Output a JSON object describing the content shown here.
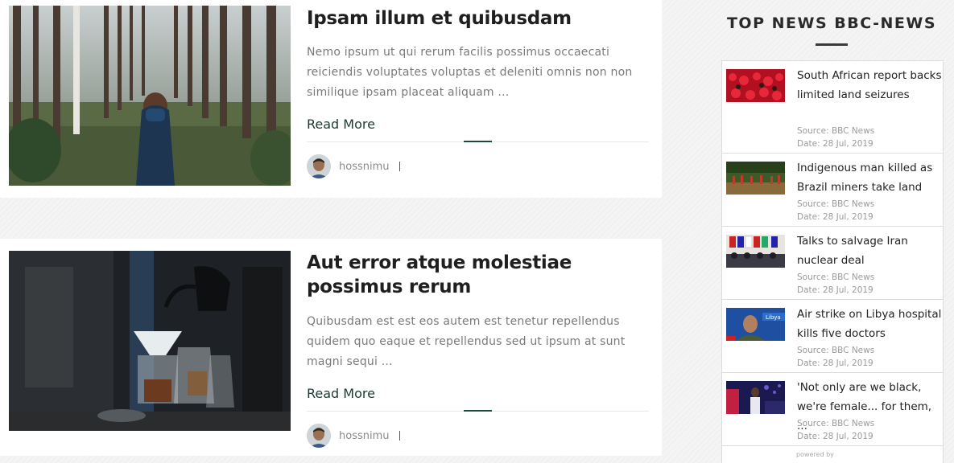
{
  "posts": [
    {
      "title": "Ipsam illum et quibusdam",
      "excerpt": "Nemo ipsum ut qui rerum facilis possimus occaecati reiciendis voluptates voluptas et deleniti omnis non non similique ipsam placeat aliquam ...",
      "read_more": "Read More",
      "author": "hossnimu",
      "image": "forest-photo"
    },
    {
      "title": "Aut error atque molestiae possimus rerum",
      "excerpt": "Quibusdam est est eos autem est tenetur repellendus quidem quo eaque et repellendus sed ut ipsum at sunt magni sequi ...",
      "read_more": "Read More",
      "author": "hossnimu",
      "image": "coffee-brewing-photo"
    }
  ],
  "sidebar": {
    "title": "TOP NEWS BBC-NEWS",
    "items": [
      {
        "headline": "South African report backs limited land seizures",
        "source": "Source: BBC News",
        "date": "Date: 28 Jul, 2019"
      },
      {
        "headline": "Indigenous man killed as Brazil miners take land",
        "source": "Source: BBC News",
        "date": "Date: 28 Jul, 2019"
      },
      {
        "headline": "Talks to salvage Iran nuclear deal",
        "source": "Source: BBC News",
        "date": "Date: 28 Jul, 2019"
      },
      {
        "headline": "Air strike on Libya hospital kills five doctors",
        "source": "Source: BBC News",
        "date": "Date: 28 Jul, 2019"
      },
      {
        "headline": "'Not only are we black, we're female... for them, ...",
        "source": "Source: BBC News",
        "date": "Date: 28 Jul, 2019"
      }
    ],
    "powered_by": "powered by"
  },
  "colors": {
    "accent": "#1c4a3f",
    "title_text": "#1f1f1f",
    "body_text": "#7a7a7a",
    "read_more": "#1c3a33"
  }
}
